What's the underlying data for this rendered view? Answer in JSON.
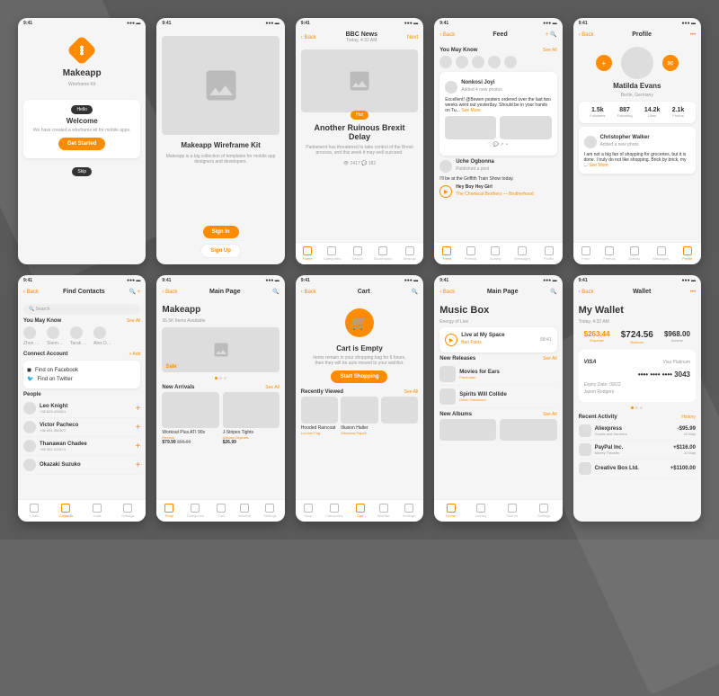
{
  "status": {
    "time": "9:41",
    "signal": "•••",
    "wifi": "📶",
    "battery": "■"
  },
  "s1": {
    "brand": "Makeapp",
    "brandSub": "Wireframe Kit",
    "hello": "Hello",
    "title": "Welcome",
    "desc": "We have created a wireframe kit for mobile apps.",
    "cta": "Get Started",
    "skip": "Skip"
  },
  "s2": {
    "title": "Makeapp Wireframe Kit",
    "desc": "Makeapp is a big collection of templates for mobile app designers and developers.",
    "signin": "Sign In",
    "signup": "Sign Up"
  },
  "s3": {
    "back": "Back",
    "source": "BBC News",
    "time": "Today, 4:32 AM",
    "next": "Next",
    "hot": "Hot",
    "title": "Another Ruinous Brexit Delay",
    "body": "Parliament has threatened to take control of the Brexit process, and this week it may well succeed.",
    "views": "2417",
    "comments": "182",
    "tabs": [
      "Home",
      "Categories",
      "Search",
      "Bookmarks",
      "Settings"
    ]
  },
  "s4": {
    "back": "Back",
    "title": "Feed",
    "may": "You May Know",
    "seeall": "See All",
    "p1name": "Nonkosi Joyi",
    "p1meta": "Added 4 new photos",
    "p1text": "Excellent! @Bowen posters ordered over the last two weeks went out yesterday. Should be in your hands on Tu...",
    "more": "See More",
    "p2name": "Uche Ogbonna",
    "p2meta": "Published a post",
    "p2text": "I'll be at the Griffith Train Show today.",
    "song": "Hey Boy Hey Girl",
    "artist": "The Chemical Brothers — Brotherhood",
    "tabs": [
      "Feed",
      "Friends",
      "Activity",
      "Messages",
      "Profile"
    ]
  },
  "s5": {
    "back": "Back",
    "title": "Profile",
    "name": "Matilda Evans",
    "loc": "Berlin, Germany",
    "stats": [
      {
        "n": "1.5k",
        "l": "Followers"
      },
      {
        "n": "887",
        "l": "Following"
      },
      {
        "n": "14.2k",
        "l": "Likes"
      },
      {
        "n": "2.1k",
        "l": "Photos"
      }
    ],
    "cw": "Christopher Walker",
    "cwmeta": "Added a new photo",
    "cwtext": "I am not a big fan of shopping for groceries, but it is done. I truly do not like shopping. Brick by brick, my ...",
    "more": "See More",
    "tabs": [
      "Feed",
      "Friends",
      "Activity",
      "Messages",
      "Profile"
    ]
  },
  "s6": {
    "back": "Back",
    "title": "Find Contacts",
    "search": "Search",
    "may": "You May Know",
    "seeall": "See All",
    "names": [
      "Zhen Han",
      "Sienna Ah...",
      "Tarak Ma...",
      "Alex Dixo..."
    ],
    "connect": "Connect Account",
    "add": "+ Add",
    "fb": "Find on Facebook",
    "tw": "Find on Twitter",
    "people": "People",
    "list": [
      {
        "n": "Leo Knight",
        "m": "+38 829-428501"
      },
      {
        "n": "Victor Pacheco",
        "m": "+38 831-560872"
      },
      {
        "n": "Thanawan Chadee",
        "m": "+48 302-411974"
      },
      {
        "n": "Okazaki Suzuko",
        "m": ""
      }
    ],
    "tabs": [
      "Chats",
      "Contacts",
      "Calls",
      "Settings"
    ]
  },
  "s7": {
    "back": "Back",
    "title": "Main Page",
    "brand": "Makeapp",
    "items": "35.5K Items Available",
    "sale": "Sale",
    "arrivals": "New Arrivals",
    "seeall": "See All",
    "p1": {
      "n": "Workout Plus ATI 90s",
      "b": "Reebok",
      "p": "$79.99",
      "o": "$99.99"
    },
    "p2": {
      "n": "J-Stripes Tights",
      "b": "Adidas Originals",
      "p": "$26.99"
    },
    "tabs": [
      "Shop",
      "Categories",
      "Cart",
      "Wishlist",
      "Settings"
    ]
  },
  "s8": {
    "back": "Back",
    "title": "Cart",
    "empty": "Cart is Empty",
    "desc": "Items remain in your shopping bag for 6 hours, then they will be auto moved to your wishlist.",
    "cta": "Start Shopping",
    "recent": "Recently Viewed",
    "seeall": "See All",
    "r1": {
      "n": "Hooded Raincoat",
      "b": "London Fog"
    },
    "r2": {
      "n": "Illusion Halter",
      "b": "Adrianna Papell"
    },
    "r3": {
      "n": "",
      "b": ""
    },
    "tabs": [
      "Shop",
      "Categories",
      "Cart",
      "Wishlist",
      "Settings"
    ]
  },
  "s9": {
    "back": "Back",
    "title": "Main Page",
    "brand": "Music Box",
    "sub": "Energy of Live",
    "track": {
      "n": "Live at My Space",
      "a": "Ben Folds",
      "t": "58:41"
    },
    "new": "New Releases",
    "seeall": "See All",
    "a1": {
      "n": "Movies for Ears",
      "a": "Parchman"
    },
    "a2": {
      "n": "Spirits Will Collide",
      "a": "Devin Townsend"
    },
    "albums": "New Albums",
    "tabs": [
      "Home",
      "Library",
      "Search",
      "Settings"
    ]
  },
  "s10": {
    "back": "Back",
    "title": "Wallet",
    "brand": "My Wallet",
    "date": "Today, 4:32 AM",
    "money": [
      {
        "amt": "$263.44",
        "lbl": "Expense",
        "cls": "exp"
      },
      {
        "amt": "$724.56",
        "lbl": "Balance",
        "cls": "balance"
      },
      {
        "amt": "$968.00",
        "lbl": "Income",
        "cls": "inc"
      }
    ],
    "card": {
      "brand": "VISA",
      "name": "Visa Platinum",
      "num": "•••• •••• •••• 3043",
      "exp": "Expiry Date: 09/22",
      "holder": "Jaxon Rodgers"
    },
    "recent": "Recent Activity",
    "history": "History",
    "tx": [
      {
        "n": "Aliexpress",
        "m": "Goods and Services",
        "a": "-$95.99",
        "d": "22 May"
      },
      {
        "n": "PayPal Inc.",
        "m": "Money Transfer",
        "a": "+$116.00",
        "d": "22 May"
      },
      {
        "n": "Creative Box Ltd.",
        "m": "",
        "a": "+$1100.00",
        "d": ""
      }
    ]
  }
}
